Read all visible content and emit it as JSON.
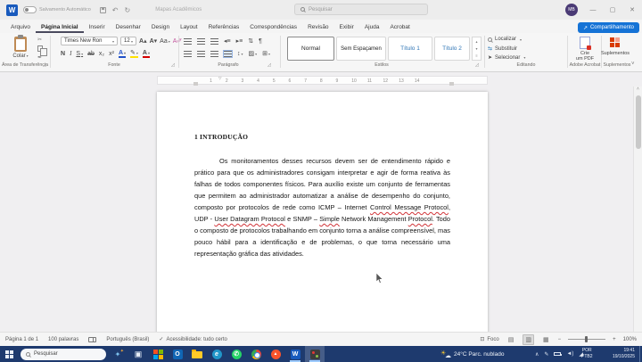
{
  "titlebar": {
    "autosave_label": "Salvamento Automático",
    "doc_title": "Mapas Acadêmicos",
    "search_placeholder": "Pesquisar",
    "avatar_initials": "MB",
    "minimize": "—",
    "maximize": "▢",
    "close": "✕",
    "share_label": "Compartilhamento"
  },
  "tabs": {
    "items": [
      "Arquivo",
      "Página Inicial",
      "Inserir",
      "Desenhar",
      "Design",
      "Layout",
      "Referências",
      "Correspondências",
      "Revisão",
      "Exibir",
      "Ajuda",
      "Acrobat"
    ],
    "active": "Página Inicial"
  },
  "ribbon": {
    "paste_label": "Colar",
    "font_name": "Times New Ron",
    "font_size": "12",
    "groups": [
      "Área de Transferência",
      "Fonte",
      "Parágrafo",
      "Estilos",
      "Editando",
      "Adobe Acrobat",
      "Suplementos"
    ],
    "styles": [
      {
        "label": "Normal",
        "selected": true,
        "color": "#222222"
      },
      {
        "label": "Sem Espaçamen",
        "selected": false,
        "color": "#222222"
      },
      {
        "label": "Título 1",
        "selected": false,
        "color": "#2e74b5"
      },
      {
        "label": "Título 2",
        "selected": false,
        "color": "#2e74b5"
      }
    ],
    "editing": [
      "Localizar",
      "Substituir",
      "Selecionar"
    ],
    "acrobat_button_line1": "Crie",
    "acrobat_button_line2": "um PDF",
    "addins_button": "Suplementos"
  },
  "document": {
    "heading": "1 INTRODUÇÃO",
    "paragraph": [
      {
        "t": "Os monitoramentos desses recursos devem ser de entendimento rápido e prático para que os administradores consigam interpretar e agir de forma reativa às falhas de todos componentes físicos. Para auxílio existe um conjunto de ferramentas que permitem ao administrador automatizar a análise de desempenho do conjunto, composto por protocolos de rede como ICMP – Internet "
      },
      {
        "t": "Control Message Protocol",
        "misspelled": true
      },
      {
        "t": ", UDP - "
      },
      {
        "t": "User Datagram Protocol",
        "misspelled": true
      },
      {
        "t": " e SNMP – "
      },
      {
        "t": "Simple",
        "misspelled": true
      },
      {
        "t": " Network Management "
      },
      {
        "t": "Protocol",
        "misspelled": true
      },
      {
        "t": ". Todo o composto de protocolos trabalhando em conjunto torna a análise compreensível, mas pouco hábil para a identificação e de problemas, o que torna necessário uma representação gráfica das atividades."
      }
    ]
  },
  "ruler": {
    "numbers": [
      1,
      2,
      3,
      4,
      5,
      6,
      7,
      8,
      9,
      10,
      11,
      12,
      13,
      14
    ]
  },
  "statusbar": {
    "page": "Página 1 de 1",
    "words": "100 palavras",
    "language": "Português (Brasil)",
    "accessibility": "Acessibilidade: tudo certo",
    "focus": "Foco",
    "zoom": "100%"
  },
  "taskbar": {
    "search_placeholder": "Pesquisar",
    "apps": [
      {
        "name": "task-view"
      },
      {
        "name": "microsoft-store"
      },
      {
        "name": "outlook"
      },
      {
        "name": "file-explorer"
      },
      {
        "name": "edge"
      },
      {
        "name": "whatsapp"
      },
      {
        "name": "chrome"
      },
      {
        "name": "brave"
      },
      {
        "name": "word",
        "open": true
      },
      {
        "name": "active-document-app",
        "open": true,
        "active": true
      }
    ],
    "weather": "24°C Parc. nublado",
    "lang_line1": "POR",
    "lang_line2": "PTB2",
    "time": "19:41",
    "date": "19/10/2025"
  },
  "colors": {
    "accent_blue": "#185abd",
    "share_blue": "#1573d6",
    "squiggle_red": "#d13438",
    "taskbar_navy": "#1e3a6e"
  }
}
